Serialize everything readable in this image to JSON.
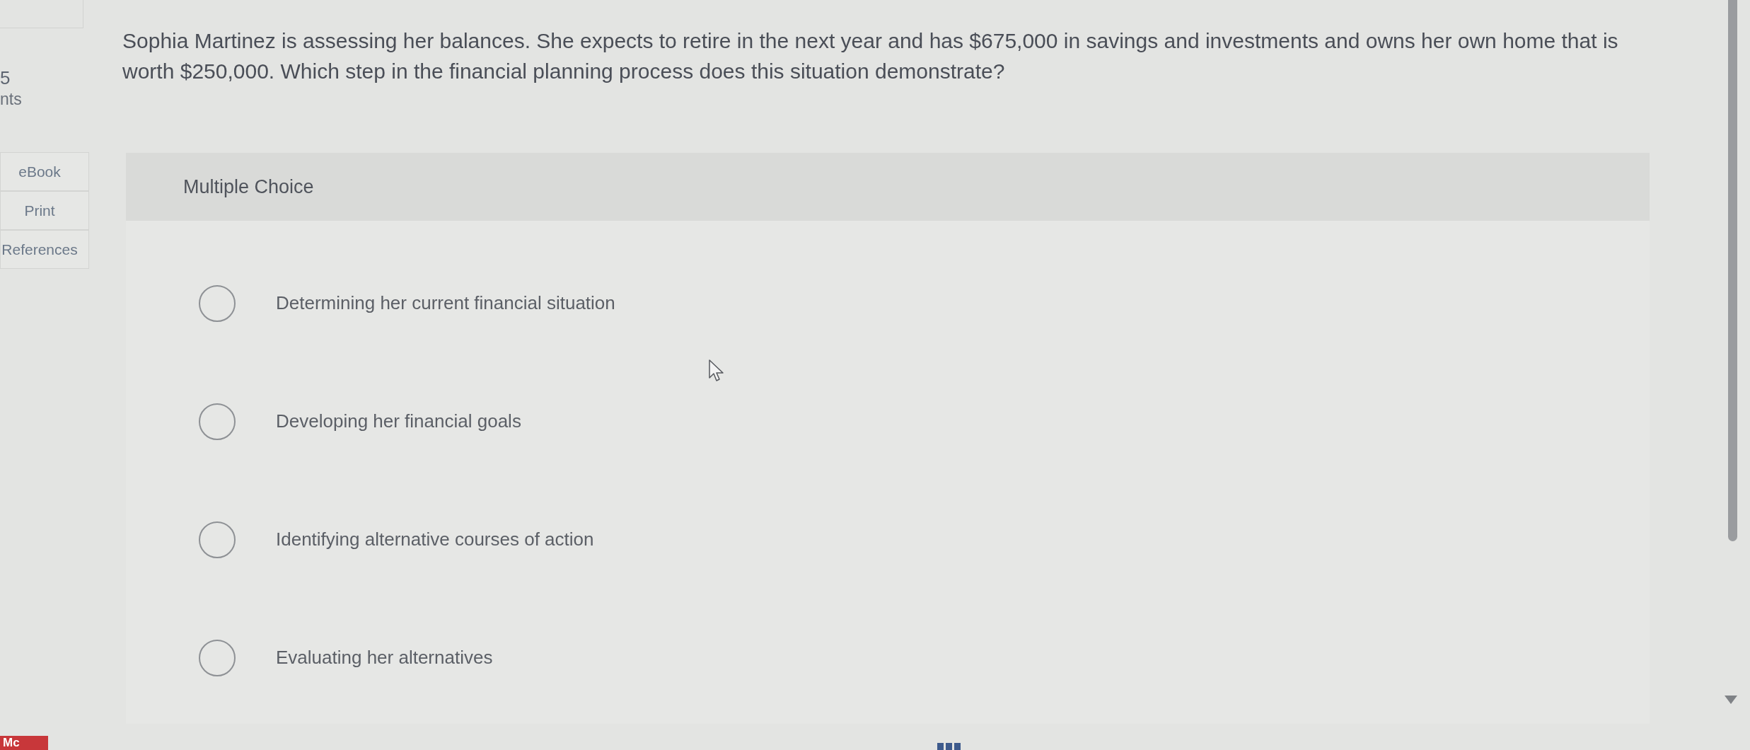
{
  "sidebar": {
    "points": {
      "value": "5",
      "label": "nts"
    },
    "tools": [
      {
        "label": "eBook"
      },
      {
        "label": "Print"
      },
      {
        "label": "References"
      }
    ]
  },
  "question": {
    "text": "Sophia Martinez is assessing her balances. She expects to retire in the next year and has $675,000 in savings and investments and owns her own home that is worth $250,000. Which step in the financial planning process does this situation demonstrate?"
  },
  "answer": {
    "type_label": "Multiple Choice",
    "options": [
      {
        "label": "Determining her current financial situation",
        "selected": false
      },
      {
        "label": "Developing her financial goals",
        "selected": false
      },
      {
        "label": "Identifying alternative courses of action",
        "selected": false
      },
      {
        "label": "Evaluating her alternatives",
        "selected": false
      }
    ]
  },
  "footer": {
    "logo": "Mc"
  }
}
